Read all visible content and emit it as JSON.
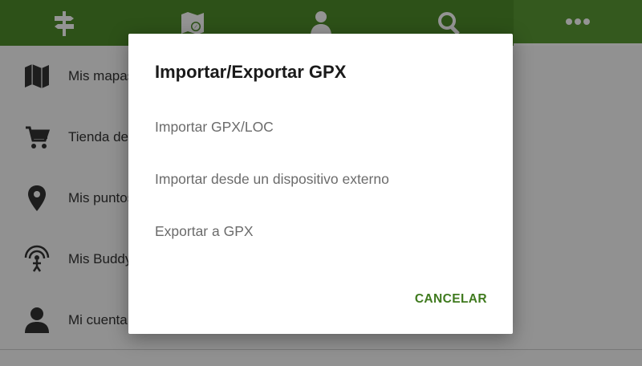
{
  "colors": {
    "tabbar_background": "#4e8c2a",
    "tabbar_active_background": "#5a9a34",
    "accent_text": "#3f7a1e"
  },
  "tabbar": {
    "tabs": [
      {
        "icon": "signpost-icon",
        "active": false
      },
      {
        "icon": "map-compass-icon",
        "active": false
      },
      {
        "icon": "person-icon",
        "active": false
      },
      {
        "icon": "search-icon",
        "active": false
      },
      {
        "icon": "more-dots-icon",
        "active": true
      }
    ]
  },
  "menu": {
    "items": [
      {
        "icon": "map-icon",
        "label": "Mis mapas"
      },
      {
        "icon": "cart-icon",
        "label": "Tienda de mapas"
      },
      {
        "icon": "location-pin-icon",
        "label": "Mis puntos"
      },
      {
        "icon": "buddy-tracker-icon",
        "label": "Mis Buddys"
      },
      {
        "icon": "account-icon",
        "label": "Mi cuenta"
      }
    ]
  },
  "dialog": {
    "title": "Importar/Exportar GPX",
    "options": [
      "Importar GPX/LOC",
      "Importar desde un dispositivo externo",
      "Exportar a GPX"
    ],
    "cancel_label": "CANCELAR"
  }
}
